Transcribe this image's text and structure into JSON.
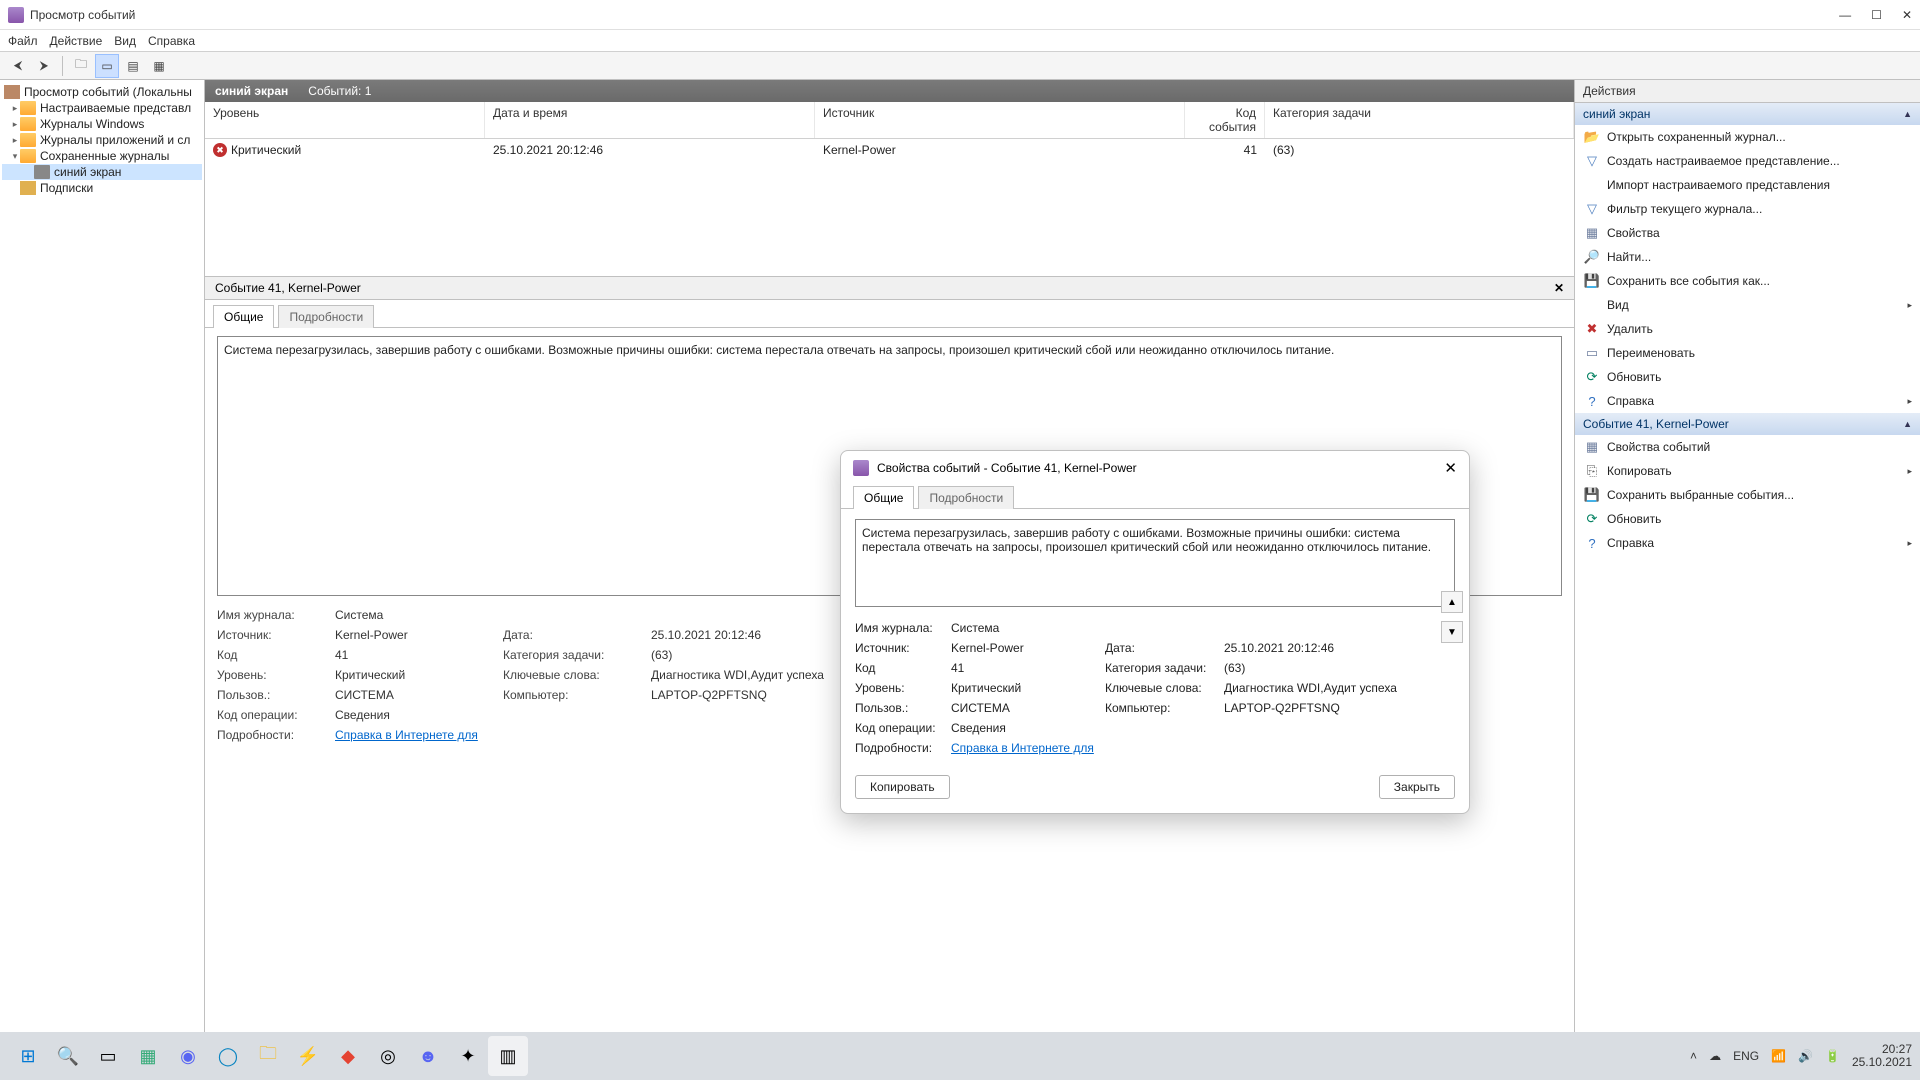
{
  "window": {
    "title": "Просмотр событий"
  },
  "menu": {
    "file": "Файл",
    "action": "Действие",
    "view": "Вид",
    "help": "Справка"
  },
  "tree": {
    "root": "Просмотр событий (Локальны",
    "custom_views": "Настраиваемые представл",
    "windows_logs": "Журналы Windows",
    "app_logs": "Журналы приложений и сл",
    "saved_logs": "Сохраненные журналы",
    "saved_blue": "синий экран",
    "subscriptions": "Подписки"
  },
  "center": {
    "header_label": "синий экран",
    "header_count": "Событий: 1",
    "cols": {
      "level": "Уровень",
      "date": "Дата и время",
      "source": "Источник",
      "code": "Код события",
      "task": "Категория задачи"
    },
    "row": {
      "level": "Критический",
      "date": "25.10.2021 20:12:46",
      "source": "Kernel-Power",
      "code": "41",
      "task": "(63)"
    },
    "detail_title": "Событие 41, Kernel-Power",
    "tabs": {
      "general": "Общие",
      "details": "Подробности"
    },
    "description": "Система перезагрузилась, завершив работу с ошибками. Возможные причины ошибки: система перестала отвечать на запросы, произошел критический сбой или неожиданно отключилось питание."
  },
  "fields": {
    "log_name_l": "Имя журнала:",
    "log_name_v": "Система",
    "source_l": "Источник:",
    "source_v": "Kernel-Power",
    "date_l": "Дата:",
    "date_v": "25.10.2021 20:12:46",
    "code_l": "Код",
    "code_v": "41",
    "task_l": "Категория задачи:",
    "task_v": "(63)",
    "level_l": "Уровень:",
    "level_v": "Критический",
    "keywords_l": "Ключевые слова:",
    "keywords_v": "Диагностика WDI,Аудит успеха",
    "user_l": "Пользов.:",
    "user_v": "СИСТЕМА",
    "computer_l": "Компьютер:",
    "computer_v": "LAPTOP-Q2PFTSNQ",
    "opcode_l": "Код операции:",
    "opcode_v": "Сведения",
    "details_l": "Подробности:",
    "details_link": "Справка в Интернете для "
  },
  "actions": {
    "hdr": "Действия",
    "section1": "синий экран",
    "open_saved": "Открыть сохраненный журнал...",
    "create_view": "Создать настраиваемое представление...",
    "import_view": "Импорт настраиваемого представления",
    "filter": "Фильтр текущего журнала...",
    "props": "Свойства",
    "find": "Найти...",
    "save_all": "Сохранить все события как...",
    "view": "Вид",
    "delete": "Удалить",
    "rename": "Переименовать",
    "refresh": "Обновить",
    "help": "Справка",
    "section2": "Событие 41, Kernel-Power",
    "ev_props": "Свойства событий",
    "copy": "Копировать",
    "save_sel": "Сохранить выбранные события...",
    "refresh2": "Обновить",
    "help2": "Справка"
  },
  "dialog": {
    "title": "Свойства событий - Событие 41, Kernel-Power",
    "copy_btn": "Копировать",
    "close_btn": "Закрыть"
  },
  "taskbar": {
    "lang": "ENG",
    "time": "20:27",
    "date": "25.10.2021"
  }
}
